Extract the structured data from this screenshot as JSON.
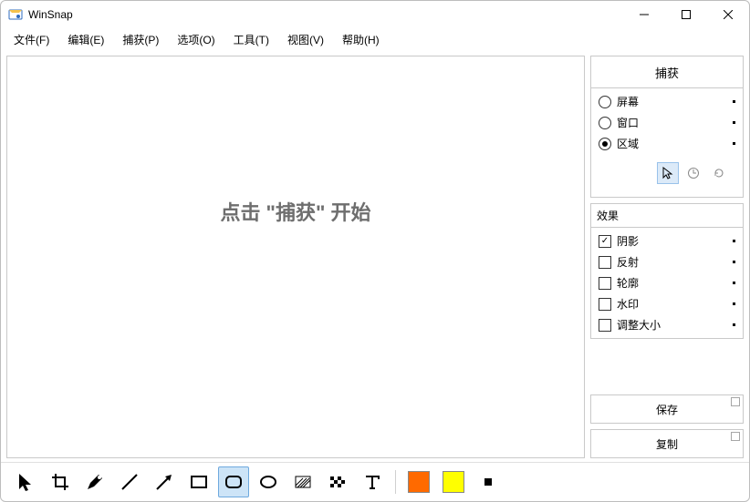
{
  "app": {
    "title": "WinSnap"
  },
  "menu": {
    "file": "文件(F)",
    "edit": "编辑(E)",
    "capture": "捕获(P)",
    "options": "选项(O)",
    "tools": "工具(T)",
    "view": "视图(V)",
    "help": "帮助(H)"
  },
  "canvas": {
    "placeholder_pre": "点击 \"",
    "placeholder_emph": "捕获",
    "placeholder_post": "\" 开始"
  },
  "capture_panel": {
    "button_label": "捕获",
    "modes": {
      "screen": "屏幕",
      "window": "窗口",
      "region": "区域",
      "selected": "region"
    }
  },
  "effects_panel": {
    "title": "效果",
    "items": {
      "shadow": {
        "label": "阴影",
        "checked": true
      },
      "reflect": {
        "label": "反射",
        "checked": false
      },
      "outline": {
        "label": "轮廓",
        "checked": false
      },
      "watermark": {
        "label": "水印",
        "checked": false
      },
      "resize": {
        "label": "调整大小",
        "checked": false
      }
    }
  },
  "actions": {
    "save": "保存",
    "copy": "复制"
  },
  "tools": {
    "selected": "roundrect",
    "colors": {
      "primary": "#ff6a00",
      "secondary": "#ffff00"
    }
  }
}
